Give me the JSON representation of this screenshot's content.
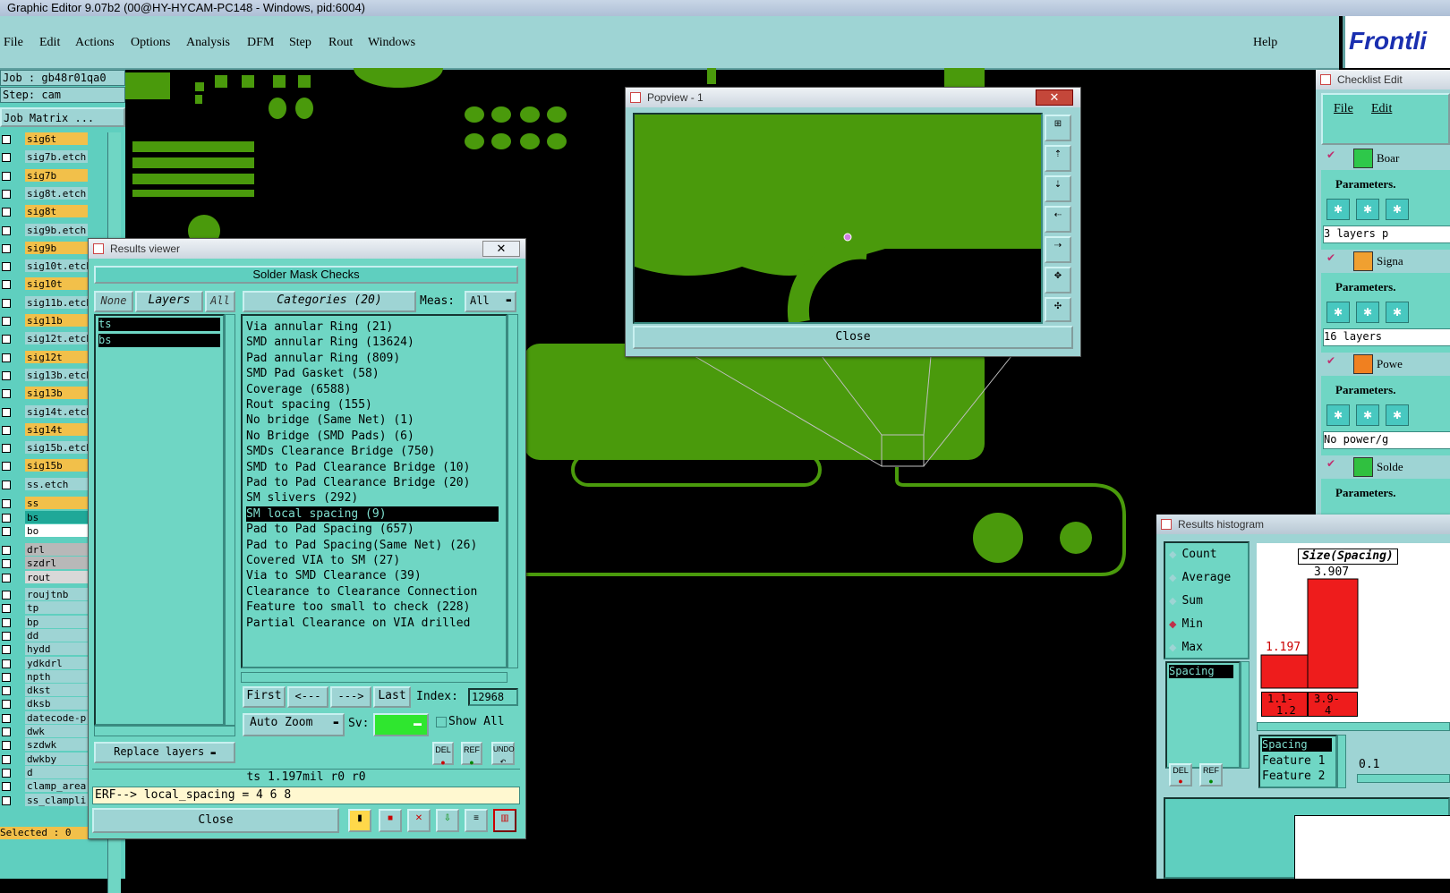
{
  "window_title": "Graphic Editor 9.07b2 (00@HY-HYCAM-PC148 - Windows, pid:6004)",
  "menu": [
    "File",
    "Edit",
    "Actions",
    "Options",
    "Analysis",
    "DFM",
    "Step",
    "Rout",
    "Windows"
  ],
  "help_label": "Help",
  "logo_text": "Frontli",
  "job": {
    "job_line": "Job : gb48r01qa0",
    "step_line": "Step: cam",
    "matrix_label": "Job Matrix ..."
  },
  "layers": [
    {
      "name": "sig6t",
      "color": "#f2c04a"
    },
    {
      "name": "sig7b.etch",
      "color": "#9ed4d4"
    },
    {
      "name": "sig7b",
      "color": "#f2c04a"
    },
    {
      "name": "sig8t.etch",
      "color": "#9ed4d4"
    },
    {
      "name": "sig8t",
      "color": "#f2c04a"
    },
    {
      "name": "sig9b.etch",
      "color": "#9ed4d4"
    },
    {
      "name": "sig9b",
      "color": "#f2c04a"
    },
    {
      "name": "sig10t.etch",
      "color": "#9ed4d4"
    },
    {
      "name": "sig10t",
      "color": "#f2c04a"
    },
    {
      "name": "sig11b.etch",
      "color": "#9ed4d4"
    },
    {
      "name": "sig11b",
      "color": "#f2c04a"
    },
    {
      "name": "sig12t.etch",
      "color": "#9ed4d4"
    },
    {
      "name": "sig12t",
      "color": "#f2c04a"
    },
    {
      "name": "sig13b.etch",
      "color": "#9ed4d4"
    },
    {
      "name": "sig13b",
      "color": "#f2c04a"
    },
    {
      "name": "sig14t.etch",
      "color": "#9ed4d4"
    },
    {
      "name": "sig14t",
      "color": "#f2c04a"
    },
    {
      "name": "sig15b.etch",
      "color": "#9ed4d4"
    },
    {
      "name": "sig15b",
      "color": "#f2c04a"
    },
    {
      "name": "ss.etch",
      "color": "#9ed4d4"
    }
  ],
  "layers2": [
    {
      "name": "ss",
      "color": "#f2c04a"
    },
    {
      "name": "bs",
      "color": "#1fa898"
    },
    {
      "name": "bo",
      "color": "#ffffff"
    }
  ],
  "layers3": [
    {
      "name": "drl",
      "color": "#b8b8b8"
    },
    {
      "name": "szdrl",
      "color": "#b8b8b8"
    },
    {
      "name": "rout",
      "color": "#d8d8d8"
    }
  ],
  "layers4": [
    "roujtnb",
    "tp",
    "bp",
    "dd",
    "hydd",
    "ydkdrl",
    "npth",
    "dkst",
    "dksb",
    "datecode-p",
    "dwk",
    "szdwk",
    "dwkby",
    "d",
    "clamp_area",
    "ss_clampli"
  ],
  "selected_status": "Selected : 0",
  "results_viewer": {
    "title": "Results viewer",
    "close_x": "✕",
    "header": "Solder Mask Checks",
    "none_btn": "None",
    "layers_btn": "Layers",
    "all_btn": "All",
    "layer_items": [
      "ts",
      "bs"
    ],
    "categories_btn": "Categories (20)",
    "meas_label": "Meas:",
    "meas_value": "All",
    "categories": [
      "Via annular Ring (21)",
      "SMD annular Ring (13624)",
      "Pad annular Ring (809)",
      "SMD Pad Gasket (58)",
      "Coverage (6588)",
      "Rout spacing (155)",
      "No bridge (Same Net) (1)",
      "No Bridge (SMD Pads) (6)",
      "SMDs Clearance Bridge (750)",
      "SMD to Pad Clearance Bridge (10)",
      "Pad to Pad Clearance Bridge (20)",
      "SM slivers (292)",
      "SM local spacing (9)",
      "Pad to Pad Spacing (657)",
      "Pad to Pad Spacing(Same Net) (26)",
      "Covered VIA to SM (27)",
      "Via to SMD Clearance (39)",
      "Clearance to Clearance Connection",
      "Feature too small to check (228)",
      "Partial Clearance on VIA drilled"
    ],
    "first_btn": "First",
    "prev_btn": "<---",
    "next_btn": "--->",
    "last_btn": "Last",
    "index_label": "Index:",
    "index_value": "12968",
    "auto_zoom": "Auto Zoom",
    "sv_label": "Sv:",
    "show_all": "Show All",
    "replace_layers": "Replace layers",
    "del_label": "DEL",
    "ref_label": "REF",
    "undo_label": "UNDO",
    "status_line": "ts 1.197mil  r0  r0",
    "erf_line": "ERF--> local_spacing = 4 6 8",
    "close_btn": "Close"
  },
  "popview": {
    "title": "Popview - 1",
    "close_btn": "Close"
  },
  "checklist": {
    "title": "Checklist Edit",
    "menu_file": "File",
    "menu_edit": "Edit",
    "items": [
      {
        "name": "Boar",
        "params": "Parameters.",
        "info": "3 layers p"
      },
      {
        "name": "Signa",
        "params": "Parameters.",
        "info": "16 layers"
      },
      {
        "name": "Powe",
        "params": "Parameters.",
        "info": "No power/g"
      },
      {
        "name": "Solde",
        "params": "Parameters.",
        "info": ""
      }
    ]
  },
  "histogram": {
    "title": "Results histogram",
    "options": [
      "Count",
      "Average",
      "Sum",
      "Min",
      "Max"
    ],
    "selected_option": "Min",
    "spacing_item": "Spacing",
    "chart_title": "Size(Spacing)",
    "bar1_label": "1.197",
    "bar2_label": "3.907",
    "bin1": "1.1-\n1.2",
    "bin1_a": "1.1-",
    "bin1_b": "1.2",
    "bin2_a": "3.9-",
    "bin2_b": "4",
    "list": [
      "Spacing",
      "Feature 1",
      "Feature 2"
    ],
    "scale_value": "0.1",
    "del_label": "DEL",
    "ref_label": "REF"
  },
  "colors": {
    "board_green": "#4a9a0c",
    "panel_teal": "#6fd6c4",
    "menubar": "#9ed4d4",
    "layer_orange": "#f2c04a",
    "hist_red": "#ee1c1c"
  }
}
